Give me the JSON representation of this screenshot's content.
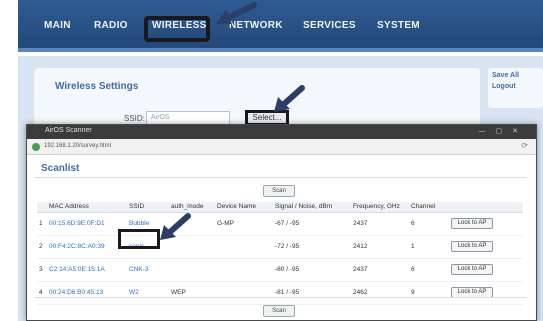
{
  "nav": {
    "items": [
      {
        "label": "MAIN"
      },
      {
        "label": "RADIO"
      },
      {
        "label": "WIRELESS"
      },
      {
        "label": "NETWORK"
      },
      {
        "label": "SERVICES"
      },
      {
        "label": "SYSTEM"
      }
    ]
  },
  "settings": {
    "title": "Wireless Settings",
    "ssid_label": "SSID:",
    "ssid_value": "AirOS",
    "select_button": "Select..."
  },
  "side": {
    "save_all": "Save All",
    "logout": "Logout"
  },
  "popup": {
    "window_title": "AirOS Scanner",
    "url": "192.168.1.20/survey.html",
    "section_title": "Scanlist",
    "scan_button": "Scan",
    "columns": [
      "MAC Address",
      "SSID",
      "auth_mode",
      "Device Name",
      "Signal / Noise, dBm",
      "Frequency, GHz",
      "Channel",
      ""
    ],
    "rows": [
      {
        "num": "1",
        "mac": "00:15:6D:9E:0F:D1",
        "ssid": "Bubble",
        "auth": "",
        "device": "G-MP",
        "signal": "-67 / -95",
        "freq": "2437",
        "channel": "6",
        "action": "Lock to AP"
      },
      {
        "num": "2",
        "mac": "00:F4:2C:8C:A0:39",
        "ssid": "sonic",
        "auth": "",
        "device": "",
        "signal": "-72 / -95",
        "freq": "2412",
        "channel": "1",
        "action": "Lock to AP"
      },
      {
        "num": "3",
        "mac": "C2:14:A5:0E:15:1A",
        "ssid": "CNK-3",
        "auth": "",
        "device": "",
        "signal": "-80 / -95",
        "freq": "2437",
        "channel": "6",
        "action": "Lock to AP"
      },
      {
        "num": "4",
        "mac": "00:24:D6:B0:45:13",
        "ssid": "W2",
        "auth": "WEP",
        "device": "",
        "signal": "-81 / -95",
        "freq": "2462",
        "channel": "9",
        "action": "Lock to AP"
      }
    ]
  }
}
